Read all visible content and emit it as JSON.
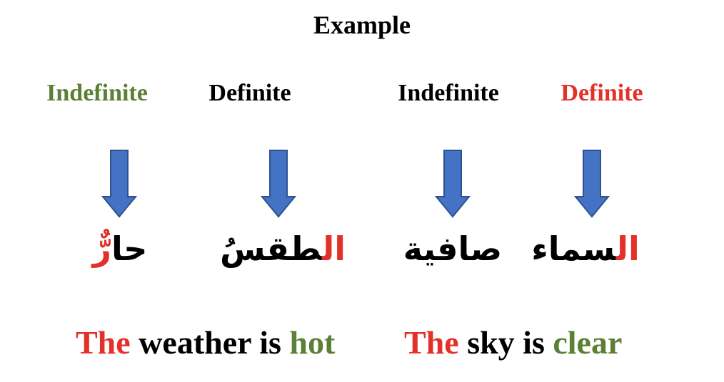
{
  "title": "Example",
  "colors": {
    "green": "#5b7f35",
    "red": "#e3312a",
    "black": "#000000",
    "arrow_fill": "#4472c4",
    "arrow_stroke": "#2f528f"
  },
  "labels": [
    {
      "text": "Indefinite",
      "color": "green"
    },
    {
      "text": "Definite",
      "color": "black"
    },
    {
      "text": "Indefinite",
      "color": "black"
    },
    {
      "text": "Definite",
      "color": "red"
    }
  ],
  "arrows": [
    "down-arrow-icon",
    "down-arrow-icon",
    "down-arrow-icon",
    "down-arrow-icon"
  ],
  "words": [
    {
      "prefix": "حا",
      "suffix": "رٌّ",
      "note": "ending highlighted red"
    },
    {
      "prefix": "ال",
      "suffix": "طقسُ",
      "note": "article highlighted red"
    },
    {
      "prefix": "صافية",
      "suffix": ""
    },
    {
      "prefix": "ال",
      "suffix": "سماء",
      "note": "article highlighted red"
    }
  ],
  "sentences": [
    {
      "the": "The",
      "middle": " weather is ",
      "end": "hot"
    },
    {
      "the": "The",
      "middle": " sky is ",
      "end": "clear"
    }
  ]
}
